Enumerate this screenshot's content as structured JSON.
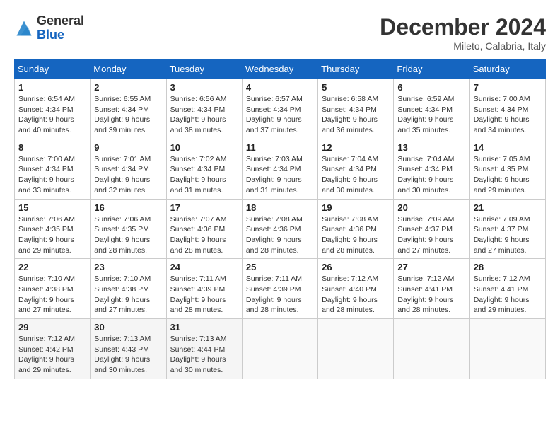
{
  "header": {
    "logo_line1": "General",
    "logo_line2": "Blue",
    "month_title": "December 2024",
    "subtitle": "Mileto, Calabria, Italy"
  },
  "weekdays": [
    "Sunday",
    "Monday",
    "Tuesday",
    "Wednesday",
    "Thursday",
    "Friday",
    "Saturday"
  ],
  "weeks": [
    [
      {
        "day": "1",
        "sunrise": "Sunrise: 6:54 AM",
        "sunset": "Sunset: 4:34 PM",
        "daylight": "Daylight: 9 hours and 40 minutes."
      },
      {
        "day": "2",
        "sunrise": "Sunrise: 6:55 AM",
        "sunset": "Sunset: 4:34 PM",
        "daylight": "Daylight: 9 hours and 39 minutes."
      },
      {
        "day": "3",
        "sunrise": "Sunrise: 6:56 AM",
        "sunset": "Sunset: 4:34 PM",
        "daylight": "Daylight: 9 hours and 38 minutes."
      },
      {
        "day": "4",
        "sunrise": "Sunrise: 6:57 AM",
        "sunset": "Sunset: 4:34 PM",
        "daylight": "Daylight: 9 hours and 37 minutes."
      },
      {
        "day": "5",
        "sunrise": "Sunrise: 6:58 AM",
        "sunset": "Sunset: 4:34 PM",
        "daylight": "Daylight: 9 hours and 36 minutes."
      },
      {
        "day": "6",
        "sunrise": "Sunrise: 6:59 AM",
        "sunset": "Sunset: 4:34 PM",
        "daylight": "Daylight: 9 hours and 35 minutes."
      },
      {
        "day": "7",
        "sunrise": "Sunrise: 7:00 AM",
        "sunset": "Sunset: 4:34 PM",
        "daylight": "Daylight: 9 hours and 34 minutes."
      }
    ],
    [
      {
        "day": "8",
        "sunrise": "Sunrise: 7:00 AM",
        "sunset": "Sunset: 4:34 PM",
        "daylight": "Daylight: 9 hours and 33 minutes."
      },
      {
        "day": "9",
        "sunrise": "Sunrise: 7:01 AM",
        "sunset": "Sunset: 4:34 PM",
        "daylight": "Daylight: 9 hours and 32 minutes."
      },
      {
        "day": "10",
        "sunrise": "Sunrise: 7:02 AM",
        "sunset": "Sunset: 4:34 PM",
        "daylight": "Daylight: 9 hours and 31 minutes."
      },
      {
        "day": "11",
        "sunrise": "Sunrise: 7:03 AM",
        "sunset": "Sunset: 4:34 PM",
        "daylight": "Daylight: 9 hours and 31 minutes."
      },
      {
        "day": "12",
        "sunrise": "Sunrise: 7:04 AM",
        "sunset": "Sunset: 4:34 PM",
        "daylight": "Daylight: 9 hours and 30 minutes."
      },
      {
        "day": "13",
        "sunrise": "Sunrise: 7:04 AM",
        "sunset": "Sunset: 4:34 PM",
        "daylight": "Daylight: 9 hours and 30 minutes."
      },
      {
        "day": "14",
        "sunrise": "Sunrise: 7:05 AM",
        "sunset": "Sunset: 4:35 PM",
        "daylight": "Daylight: 9 hours and 29 minutes."
      }
    ],
    [
      {
        "day": "15",
        "sunrise": "Sunrise: 7:06 AM",
        "sunset": "Sunset: 4:35 PM",
        "daylight": "Daylight: 9 hours and 29 minutes."
      },
      {
        "day": "16",
        "sunrise": "Sunrise: 7:06 AM",
        "sunset": "Sunset: 4:35 PM",
        "daylight": "Daylight: 9 hours and 28 minutes."
      },
      {
        "day": "17",
        "sunrise": "Sunrise: 7:07 AM",
        "sunset": "Sunset: 4:36 PM",
        "daylight": "Daylight: 9 hours and 28 minutes."
      },
      {
        "day": "18",
        "sunrise": "Sunrise: 7:08 AM",
        "sunset": "Sunset: 4:36 PM",
        "daylight": "Daylight: 9 hours and 28 minutes."
      },
      {
        "day": "19",
        "sunrise": "Sunrise: 7:08 AM",
        "sunset": "Sunset: 4:36 PM",
        "daylight": "Daylight: 9 hours and 28 minutes."
      },
      {
        "day": "20",
        "sunrise": "Sunrise: 7:09 AM",
        "sunset": "Sunset: 4:37 PM",
        "daylight": "Daylight: 9 hours and 27 minutes."
      },
      {
        "day": "21",
        "sunrise": "Sunrise: 7:09 AM",
        "sunset": "Sunset: 4:37 PM",
        "daylight": "Daylight: 9 hours and 27 minutes."
      }
    ],
    [
      {
        "day": "22",
        "sunrise": "Sunrise: 7:10 AM",
        "sunset": "Sunset: 4:38 PM",
        "daylight": "Daylight: 9 hours and 27 minutes."
      },
      {
        "day": "23",
        "sunrise": "Sunrise: 7:10 AM",
        "sunset": "Sunset: 4:38 PM",
        "daylight": "Daylight: 9 hours and 27 minutes."
      },
      {
        "day": "24",
        "sunrise": "Sunrise: 7:11 AM",
        "sunset": "Sunset: 4:39 PM",
        "daylight": "Daylight: 9 hours and 28 minutes."
      },
      {
        "day": "25",
        "sunrise": "Sunrise: 7:11 AM",
        "sunset": "Sunset: 4:39 PM",
        "daylight": "Daylight: 9 hours and 28 minutes."
      },
      {
        "day": "26",
        "sunrise": "Sunrise: 7:12 AM",
        "sunset": "Sunset: 4:40 PM",
        "daylight": "Daylight: 9 hours and 28 minutes."
      },
      {
        "day": "27",
        "sunrise": "Sunrise: 7:12 AM",
        "sunset": "Sunset: 4:41 PM",
        "daylight": "Daylight: 9 hours and 28 minutes."
      },
      {
        "day": "28",
        "sunrise": "Sunrise: 7:12 AM",
        "sunset": "Sunset: 4:41 PM",
        "daylight": "Daylight: 9 hours and 29 minutes."
      }
    ],
    [
      {
        "day": "29",
        "sunrise": "Sunrise: 7:12 AM",
        "sunset": "Sunset: 4:42 PM",
        "daylight": "Daylight: 9 hours and 29 minutes."
      },
      {
        "day": "30",
        "sunrise": "Sunrise: 7:13 AM",
        "sunset": "Sunset: 4:43 PM",
        "daylight": "Daylight: 9 hours and 30 minutes."
      },
      {
        "day": "31",
        "sunrise": "Sunrise: 7:13 AM",
        "sunset": "Sunset: 4:44 PM",
        "daylight": "Daylight: 9 hours and 30 minutes."
      },
      null,
      null,
      null,
      null
    ]
  ]
}
